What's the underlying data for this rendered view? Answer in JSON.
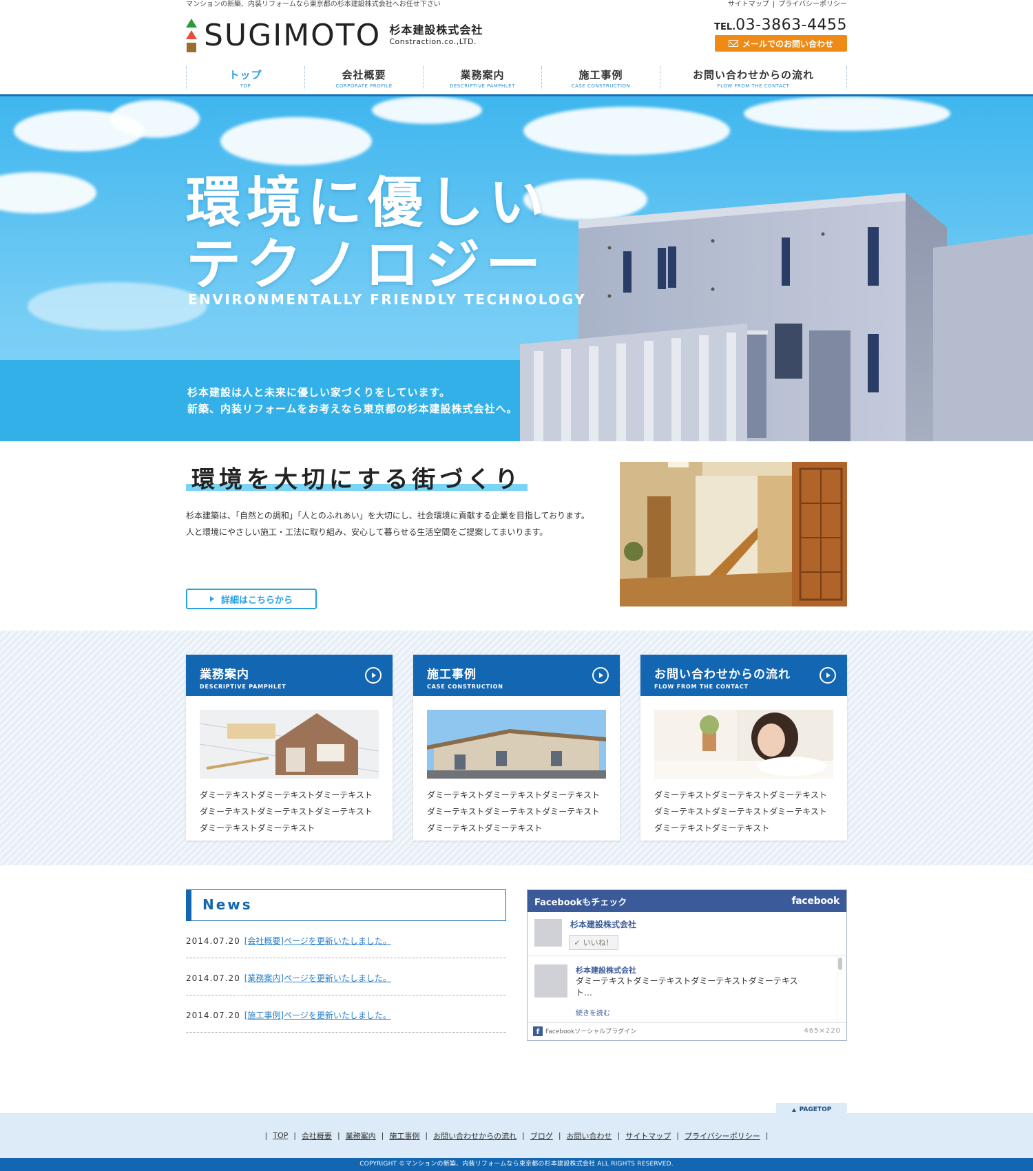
{
  "header": {
    "tagline": "マンションの新築、内装リフォームなら東京都の杉本建設株式会社へお任せ下さい",
    "toplinks": [
      "サイトマップ",
      "プライバシーポリシー"
    ],
    "logo_en": "SUGIMOTO",
    "logo_jp": "杉本建設株式会社",
    "logo_co": "Constraction.co.,LTD.",
    "tel_label": "TEL.",
    "tel": "03-3863-4455",
    "mail_button": "メールでのお問い合わせ",
    "nav": [
      {
        "jp": "トップ",
        "en": "TOP"
      },
      {
        "jp": "会社概要",
        "en": "CORPORATE PROFILE"
      },
      {
        "jp": "業務案内",
        "en": "DESCRIPTIVE PAMPHLET"
      },
      {
        "jp": "施工事例",
        "en": "CASE CONSTRUCTION"
      },
      {
        "jp": "お問い合わせからの流れ",
        "en": "FLOW FROM THE CONTACT"
      }
    ]
  },
  "hero": {
    "title_line1": "環境に優しい",
    "title_line2": "テクノロジー",
    "subtitle": "ENVIRONMENTALLY FRIENDLY TECHNOLOGY",
    "lead1": "杉本建設は人と未来に優しい家づくりをしています。",
    "lead2": "新築、内装リフォームをお考えなら東京都の杉本建設株式会社へ。"
  },
  "about": {
    "heading": "環境を大切にする街づくり",
    "text1": "杉本建築は、「自然との調和」「人とのふれあい」を大切にし、社会環境に貢献する企業を目指しております。",
    "text2": "人と環境にやさしい施工・工法に取り組み、安心して暮らせる生活空間をご提案してまいります。",
    "button": "詳細はこちらから"
  },
  "cards": [
    {
      "jp": "業務案内",
      "en": "DESCRIPTIVE PAMPHLET",
      "text": "ダミーテキストダミーテキストダミーテキストダミーテキストダミーテキストダミーテキストダミーテキストダミーテキスト"
    },
    {
      "jp": "施工事例",
      "en": "CASE CONSTRUCTION",
      "text": "ダミーテキストダミーテキストダミーテキストダミーテキストダミーテキストダミーテキストダミーテキストダミーテキスト"
    },
    {
      "jp": "お問い合わせからの流れ",
      "en": "FLOW FROM THE CONTACT",
      "text": "ダミーテキストダミーテキストダミーテキストダミーテキストダミーテキストダミーテキストダミーテキストダミーテキスト"
    }
  ],
  "news": {
    "title": "News",
    "items": [
      {
        "date": "2014.07.20",
        "text": "[会社概要]ページを更新いたしました。"
      },
      {
        "date": "2014.07.20",
        "text": "[業務案内]ページを更新いたしました。"
      },
      {
        "date": "2014.07.20",
        "text": "[施工事例]ページを更新いたしました。"
      }
    ]
  },
  "facebook": {
    "header": "Facebookもチェック",
    "brand": "facebook",
    "page_name": "杉本建設株式会社",
    "like": "いいね！",
    "post_name": "杉本建設株式会社",
    "post_text": "ダミーテキストダミーテキストダミーテキストダミーテキスト…",
    "read_more": "続きを読む",
    "plugin": "Facebookソーシャルプラグイン",
    "size": "465×220"
  },
  "footer": {
    "pagetop": "PAGETOP",
    "links": [
      "TOP",
      "会社概要",
      "業務案内",
      "施工事例",
      "お問い合わせからの流れ",
      "ブログ",
      "お問い合わせ",
      "サイトマップ",
      "プライバシーポリシー"
    ],
    "copyright": "COPYRIGHT ©マンションの新築、内装リフォームなら東京都の杉本建設株式会社 ALL RIGHTS RESERVED."
  },
  "colors": {
    "primary": "#1366b1",
    "accent": "#29a0e0",
    "orange": "#f08a16",
    "facebook": "#3b5a9a"
  }
}
